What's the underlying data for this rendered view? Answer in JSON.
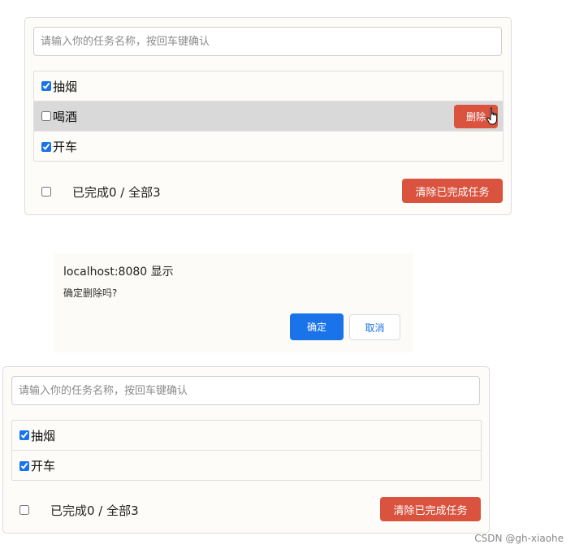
{
  "panel1": {
    "input_placeholder": "请输入你的任务名称，按回车键确认",
    "items": [
      {
        "label": "抽烟",
        "checked": true
      },
      {
        "label": "喝酒",
        "checked": false,
        "hovered": true
      },
      {
        "label": "开车",
        "checked": true
      }
    ],
    "delete_label": "删除",
    "summary": "已完成0 / 全部3",
    "clear_label": "清除已完成任务"
  },
  "dialog": {
    "title": "localhost:8080 显示",
    "message": "确定删除吗?",
    "ok_label": "确定",
    "cancel_label": "取消"
  },
  "panel2": {
    "input_placeholder": "请输入你的任务名称，按回车键确认",
    "items": [
      {
        "label": "抽烟",
        "checked": true
      },
      {
        "label": "开车",
        "checked": true
      }
    ],
    "summary": "已完成0 / 全部3",
    "clear_label": "清除已完成任务"
  },
  "watermark": "CSDN @gh-xiaohe",
  "colors": {
    "accent": "#1a73e8",
    "danger": "#d9533f",
    "hover_row": "#d9d9d9"
  }
}
